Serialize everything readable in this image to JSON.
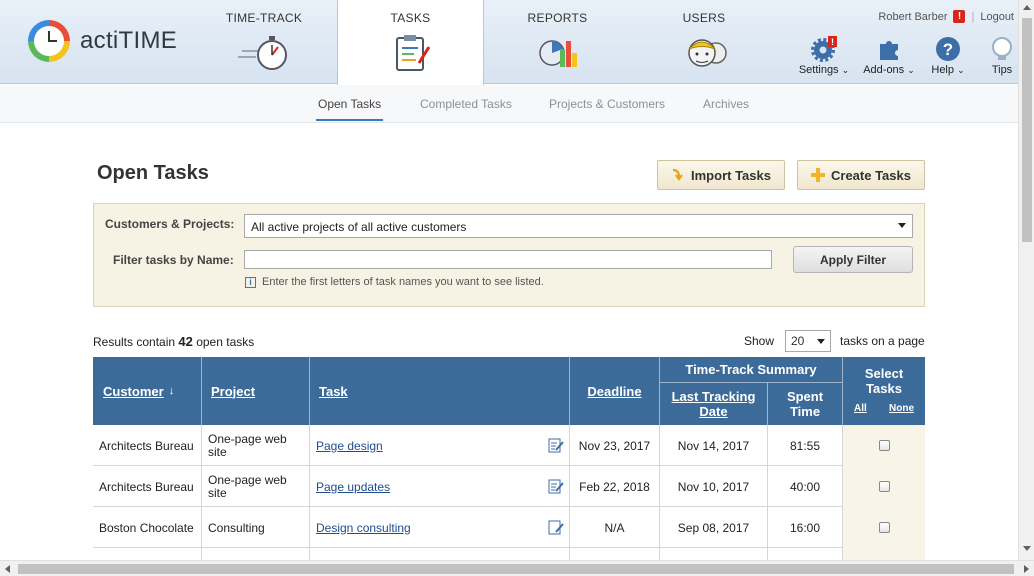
{
  "app": {
    "logo_text": "actiTIME"
  },
  "nav": {
    "tabs": [
      {
        "label": "TIME-TRACK"
      },
      {
        "label": "TASKS"
      },
      {
        "label": "REPORTS"
      },
      {
        "label": "USERS"
      }
    ],
    "active_tab": "TASKS"
  },
  "user": {
    "name": "Robert Barber",
    "alert": "!",
    "separator": "|",
    "logout": "Logout"
  },
  "tools": {
    "settings": "Settings",
    "addons": "Add-ons",
    "help": "Help",
    "tips": "Tips",
    "settings_badge": "!",
    "caret": "⌄"
  },
  "subnav": {
    "tabs": [
      "Open Tasks",
      "Completed Tasks",
      "Projects & Customers",
      "Archives"
    ],
    "active": "Open Tasks"
  },
  "page": {
    "title": "Open Tasks",
    "import_button": "Import Tasks",
    "create_button": "Create Tasks"
  },
  "filter": {
    "customers_label": "Customers & Projects:",
    "customers_value": "All active projects of all active customers",
    "name_label": "Filter tasks by Name:",
    "name_value": "",
    "apply_button": "Apply Filter",
    "hint": "Enter the first letters of task names you want to see listed."
  },
  "results": {
    "prefix": "Results contain",
    "count": "42",
    "suffix": "open tasks",
    "show_label": "Show",
    "per_page": "20",
    "per_page_suffix": "tasks on a page"
  },
  "table": {
    "headers": {
      "customer": "Customer",
      "customer_sort": "↓",
      "project": "Project",
      "task": "Task",
      "deadline": "Deadline",
      "tt_summary": "Time-Track Summary",
      "last_tracking": "Last Tracking Date",
      "spent_time": "Spent Time",
      "select_tasks": "Select Tasks",
      "all": "All",
      "none": "None"
    },
    "rows": [
      {
        "customer": "Architects Bureau",
        "project": "One-page web site",
        "task": "Page design",
        "deadline": "Nov 23, 2017",
        "last_tracking": "Nov 14, 2017",
        "spent": "81:55",
        "selected": false
      },
      {
        "customer": "Architects Bureau",
        "project": "One-page web site",
        "task": "Page updates",
        "deadline": "Feb 22, 2018",
        "last_tracking": "Nov 10, 2017",
        "spent": "40:00",
        "selected": false
      },
      {
        "customer": "Boston Chocolate",
        "project": "Consulting",
        "task": "Design consulting",
        "deadline": "N/A",
        "last_tracking": "Sep 08, 2017",
        "spent": "16:00",
        "selected": false
      }
    ]
  },
  "colors": {
    "table_header": "#3d6b99",
    "accent_blue": "#3c7ab7",
    "filter_bg": "#f7f3e4",
    "alert_red": "#d9261c"
  }
}
